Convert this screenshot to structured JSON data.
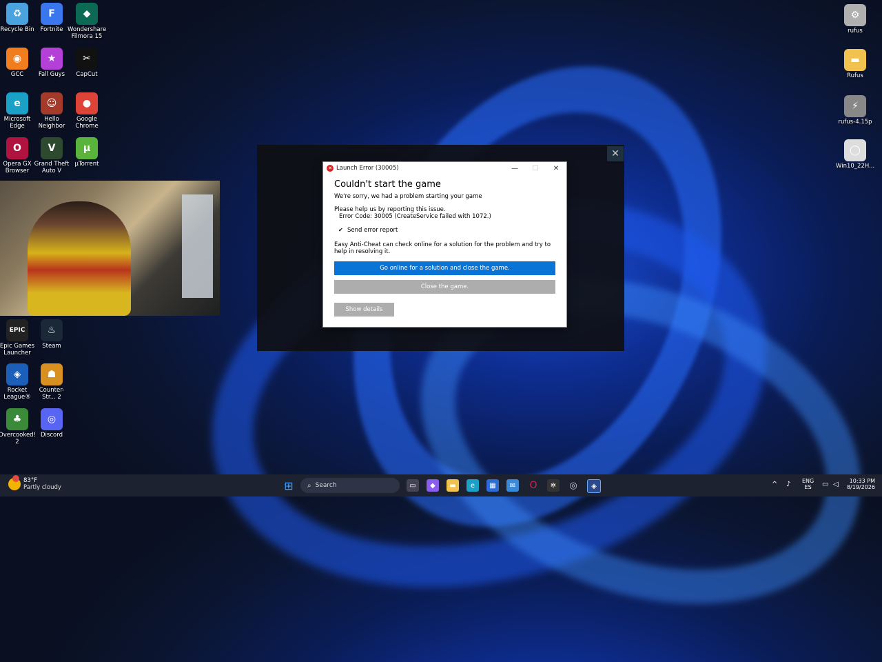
{
  "desktop_left": [
    {
      "label": "Recycle Bin",
      "name": "recycle-bin",
      "icon": "♻",
      "color": "#4aa3df"
    },
    {
      "label": "Fortnite",
      "name": "fortnite",
      "icon": "F",
      "color": "#3a77ee"
    },
    {
      "label": "Wondershare Filmora 15",
      "name": "filmora",
      "icon": "◆",
      "color": "#0c6a54"
    },
    {
      "label": "GCC",
      "name": "gcc",
      "icon": "◉",
      "color": "#f07d1e"
    },
    {
      "label": "Fall Guys",
      "name": "fall-guys",
      "icon": "★",
      "color": "#b440d8"
    },
    {
      "label": "CapCut",
      "name": "capcut",
      "icon": "✂",
      "color": "#111111"
    },
    {
      "label": "Microsoft Edge",
      "name": "edge",
      "icon": "e",
      "color": "#1ba1c8"
    },
    {
      "label": "Hello Neighbor",
      "name": "hello-neighbor",
      "icon": "☺",
      "color": "#a33a2a"
    },
    {
      "label": "Google Chrome",
      "name": "chrome",
      "icon": "●",
      "color": "#dd4437"
    },
    {
      "label": "Opera GX Browser",
      "name": "opera-gx",
      "icon": "O",
      "color": "#b0133f"
    },
    {
      "label": "Grand Theft Auto V",
      "name": "gta-v",
      "icon": "V",
      "color": "#2e4a2e"
    },
    {
      "label": "µTorrent",
      "name": "utorrent",
      "icon": "µ",
      "color": "#5ab33b"
    },
    {
      "label": "Epic Games Launcher",
      "name": "epic",
      "icon": "EPIC",
      "color": "#222222"
    },
    {
      "label": "Steam",
      "name": "steam",
      "icon": "♨",
      "color": "#1b2838"
    },
    {
      "label": "Rocket League®",
      "name": "rocket-league",
      "icon": "◈",
      "color": "#1b5fb8"
    },
    {
      "label": "Counter-Str... 2",
      "name": "cs2",
      "icon": "☗",
      "color": "#d89020"
    },
    {
      "label": "Overcooked! 2",
      "name": "overcooked",
      "icon": "♣",
      "color": "#3a8a3a"
    },
    {
      "label": "Discord",
      "name": "discord",
      "icon": "◎",
      "color": "#5865f2"
    }
  ],
  "desktop_right": [
    {
      "label": "rufus",
      "name": "rufus-exe",
      "icon": "⚙",
      "color": "#b0b0b0"
    },
    {
      "label": "Rufus",
      "name": "rufus-folder",
      "icon": "▬",
      "color": "#f2c24f"
    },
    {
      "label": "rufus-4.15p",
      "name": "rufus-415p",
      "icon": "⚡",
      "color": "#888888"
    },
    {
      "label": "Win10_22H...",
      "name": "win10-iso",
      "icon": "◯",
      "color": "#dddddd"
    }
  ],
  "launcher": {
    "close": "✕"
  },
  "dialog": {
    "title": "Launch Error (30005)",
    "heading": "Couldn't start the game",
    "sorry": "We're sorry, we had a problem starting your game",
    "report": "Please help us by reporting this issue.",
    "error_code": "Error Code: 30005 (CreateService failed with 1072.)",
    "checkbox_mark": "✔",
    "checkbox_label": "Send error report",
    "info": "Easy Anti-Cheat can check online for a solution for the problem and try to help in resolving it.",
    "btn_online": "Go online for a solution and close the game.",
    "btn_close": "Close the game.",
    "btn_details": "Show details",
    "minimize": "—",
    "maximize": "☐",
    "close": "✕"
  },
  "taskbar": {
    "temperature": "83°F",
    "weather": "Partly cloudy",
    "search_placeholder": "Search",
    "lang1": "ENG",
    "lang2": "ES",
    "time": "10:33 PM",
    "date": "8/19/2026"
  }
}
